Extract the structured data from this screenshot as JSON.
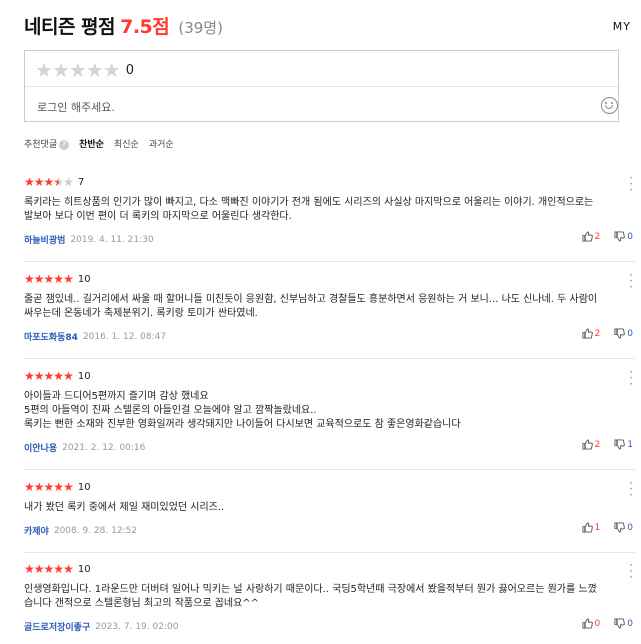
{
  "header": {
    "title": "네티즌 평점",
    "score": "7.5점",
    "count": "(39명)",
    "my_label": "MY"
  },
  "rate_box": {
    "value": "0",
    "placeholder": "로그인 해주세요."
  },
  "sort": {
    "label": "추천댓글",
    "help": "?",
    "options": [
      "찬반순",
      "최신순",
      "과거순"
    ],
    "active": "찬반순"
  },
  "reviews": [
    {
      "stars": 3.5,
      "score": "7",
      "text": "록키라는 히트상품의 인기가 많이 빠지고, 다소 맥빠진 이야기가 전개 됨에도 시리즈의 사실상 마지막으로 어울리는 이야기. 개인적으로는 발보아 보다 이번 편이 더 록키의 마지막으로 어울린다 생각한다.",
      "author": "하늘비광범",
      "date": "2019. 4. 11. 21:30",
      "up": "2",
      "down": "0"
    },
    {
      "stars": 5,
      "score": "10",
      "text": "줄곧 잼있네.. 길거리에서 싸울 때 할머니들 미친듯이 응원함, 신부님하고 경찰들도 흥분하면서 응원하는 거 보니... 나도 신나네. 두 사람이 싸우는데 온동네가 축제분위기. 록키랑 토미가 싼타였네.",
      "author": "마포도화동84",
      "date": "2016. 1. 12. 08:47",
      "up": "2",
      "down": "0"
    },
    {
      "stars": 5,
      "score": "10",
      "text": "아이들과 드디어5편까지 즐기며 감상 했네요\n5편의 아들역이 진짜 스텔론의 아들인걸 오늘에야 알고 깜짝놀랐네요..\n록키는 뻔한 소재와 진부한 영화일꺼라 생각돼지만 나이들어 다시보면 교육적으로도 참 좋은영화같습니다",
      "author": "이안나용",
      "date": "2021. 2. 12. 00:16",
      "up": "2",
      "down": "1"
    },
    {
      "stars": 5,
      "score": "10",
      "text": "내가 봤던 록키 중에서 제일 재미있었던 시리즈..",
      "author": "카제야",
      "date": "2008. 9. 28. 12:52",
      "up": "1",
      "down": "0"
    },
    {
      "stars": 5,
      "score": "10",
      "text": "인생영화입니다.  1라운드만 더버텨 일어나  믹키는 널 사랑하기 때문이다..  국딩5학년때 극장에서 봤을적부터 뭔가 끓어오르는 뭔가를 느꼈습니다   갠적으로 스텔론형님 최고의 작품으로 꼽네요^^",
      "author": "골드로저장이좋구",
      "date": "2023. 7. 19. 02:00",
      "up": "0",
      "down": "0"
    }
  ]
}
